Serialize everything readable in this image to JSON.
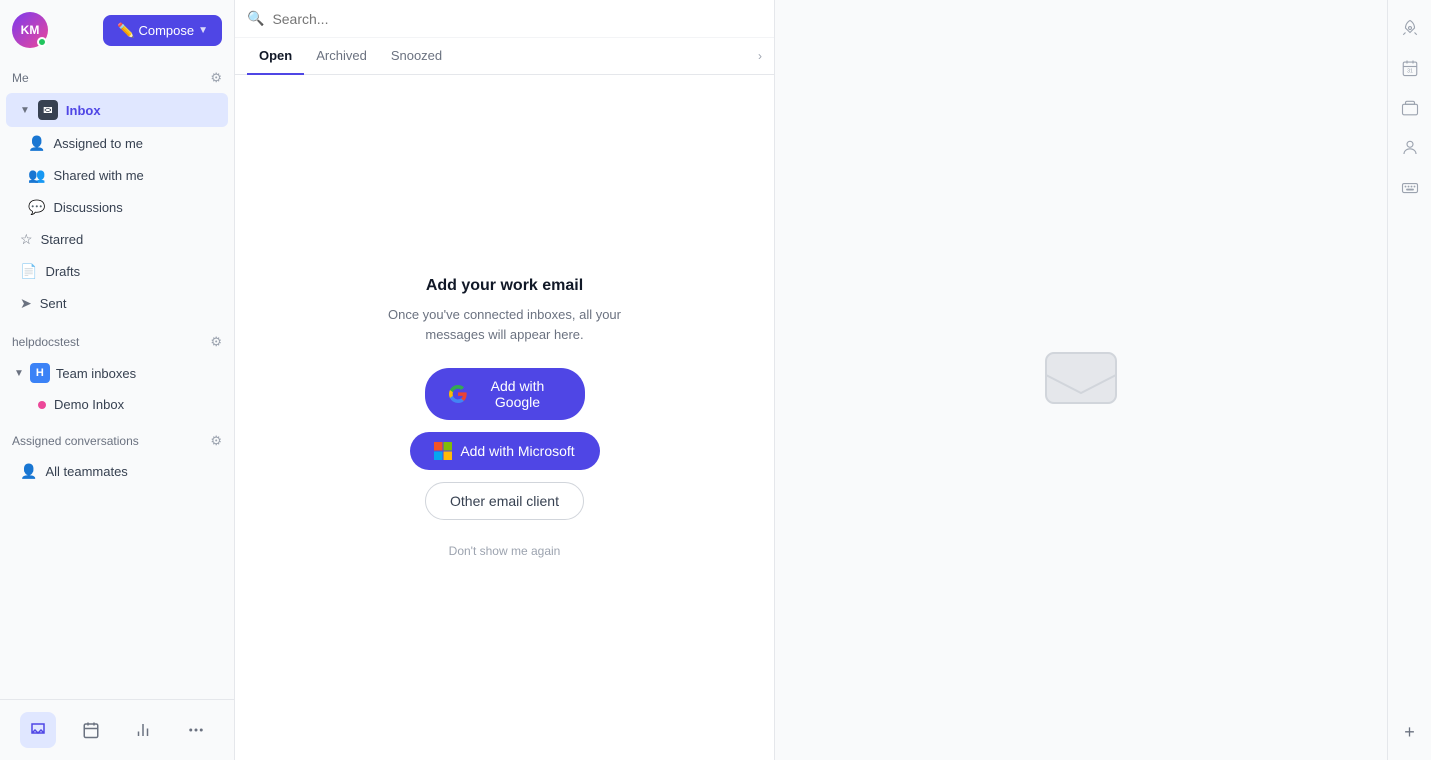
{
  "sidebar": {
    "me_label": "Me",
    "avatar_initials": "KM",
    "compose_label": "Compose",
    "inbox_label": "Inbox",
    "sub_items": [
      {
        "id": "assigned",
        "label": "Assigned to me",
        "icon": "person"
      },
      {
        "id": "shared",
        "label": "Shared with me",
        "icon": "people"
      },
      {
        "id": "discussions",
        "label": "Discussions",
        "icon": "chat"
      }
    ],
    "standalone_items": [
      {
        "id": "starred",
        "label": "Starred",
        "icon": "star"
      },
      {
        "id": "drafts",
        "label": "Drafts",
        "icon": "draft"
      },
      {
        "id": "sent",
        "label": "Sent",
        "icon": "send"
      }
    ],
    "team_section_label": "helpdocstest",
    "team_inboxes_label": "Team inboxes",
    "team_badge": "H",
    "demo_inbox_label": "Demo Inbox",
    "assigned_conversations_label": "Assigned conversations",
    "all_teammates_label": "All teammates"
  },
  "search": {
    "placeholder": "Search..."
  },
  "tabs": [
    {
      "id": "open",
      "label": "Open",
      "active": true
    },
    {
      "id": "archived",
      "label": "Archived",
      "active": false
    },
    {
      "id": "snoozed",
      "label": "Snoozed",
      "active": false
    }
  ],
  "empty_state": {
    "title": "Add your work email",
    "description": "Once you've connected inboxes, all your messages will appear here.",
    "btn_google": "Add with Google",
    "btn_microsoft": "Add with Microsoft",
    "btn_other": "Other email client",
    "dont_show": "Don't show me again"
  },
  "right_sidebar": {
    "icons": [
      "rocket",
      "calendar",
      "layers",
      "person",
      "keyboard"
    ]
  }
}
